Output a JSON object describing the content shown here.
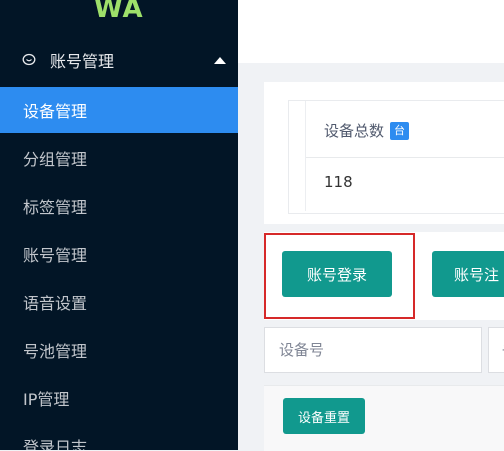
{
  "app": {
    "logo": "WA"
  },
  "sidebar": {
    "group": {
      "label": "账号管理",
      "icon": "chat-bubble-icon",
      "expanded": true
    },
    "items": [
      {
        "label": "设备管理",
        "active": true
      },
      {
        "label": "分组管理",
        "active": false
      },
      {
        "label": "标签管理",
        "active": false
      },
      {
        "label": "账号管理",
        "active": false
      },
      {
        "label": "语音设置",
        "active": false
      },
      {
        "label": "号池管理",
        "active": false
      },
      {
        "label": "IP管理",
        "active": false
      },
      {
        "label": "登录日志",
        "active": false
      }
    ]
  },
  "stats": {
    "label": "设备总数",
    "unit": "台",
    "value": "118"
  },
  "actions": {
    "login_label": "账号登录",
    "register_label": "账号注"
  },
  "search": {
    "device_placeholder": "设备号",
    "second_placeholder": "设"
  },
  "table": {
    "reset_label": "设备重置"
  },
  "colors": {
    "sidebar_bg": "#021526",
    "active_item": "#2d8cf0",
    "primary_button": "#11998e",
    "logo": "#9ee06a",
    "highlight": "#d62929"
  }
}
